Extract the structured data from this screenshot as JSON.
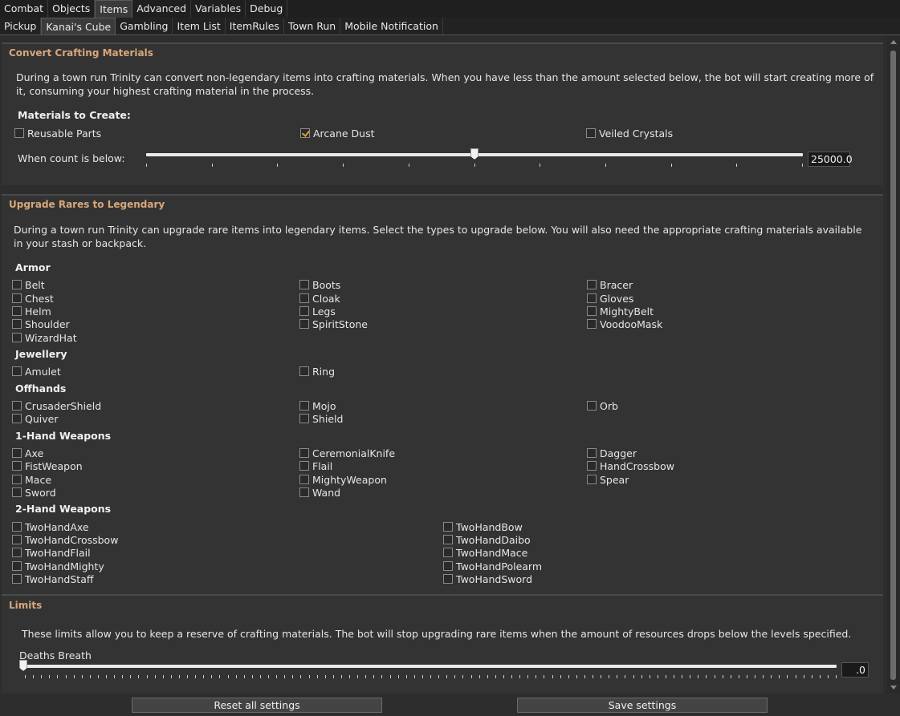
{
  "tabs_top": [
    "Combat",
    "Objects",
    "Items",
    "Advanced",
    "Variables",
    "Debug"
  ],
  "tabs_sub": [
    "Pickup",
    "Kanai's Cube",
    "Gambling",
    "Item List",
    "ItemRules",
    "Town Run",
    "Mobile Notification"
  ],
  "convert": {
    "title": "Convert Crafting Materials",
    "description": "During a town run Trinity can convert non-legendary items into crafting materials. When you have less than the amount selected below, the bot will start creating more of it, consuming your highest crafting material in the process.",
    "materials_label": "Materials to Create:",
    "materials": [
      {
        "label": "Reusable Parts",
        "checked": false
      },
      {
        "label": "Arcane Dust",
        "checked": true
      },
      {
        "label": "Veiled Crystals",
        "checked": false
      }
    ],
    "count_label": "When count is below:",
    "count_value": "25000.0",
    "count_fraction": 0.5
  },
  "upgrade": {
    "title": "Upgrade Rares to Legendary",
    "description": "During a town run Trinity can upgrade rare items into legendary items. Select the types to upgrade below. You will also need the appropriate crafting materials available in your stash or backpack.",
    "groups": {
      "armor": {
        "label": "Armor",
        "items": [
          "Belt",
          "Boots",
          "Bracer",
          "Chest",
          "Cloak",
          "Gloves",
          "Helm",
          "Legs",
          "MightyBelt",
          "Shoulder",
          "SpiritStone",
          "VoodooMask",
          "WizardHat"
        ]
      },
      "jewellery": {
        "label": "Jewellery",
        "items": [
          "Amulet",
          "Ring"
        ]
      },
      "offhands": {
        "label": "Offhands",
        "items": [
          "CrusaderShield",
          "Mojo",
          "Orb",
          "Quiver",
          "Shield"
        ]
      },
      "onehand": {
        "label": "1-Hand Weapons",
        "items": [
          "Axe",
          "CeremonialKnife",
          "Dagger",
          "FistWeapon",
          "Flail",
          "HandCrossbow",
          "Mace",
          "MightyWeapon",
          "Spear",
          "Sword",
          "Wand"
        ]
      },
      "twohand": {
        "label": "2-Hand Weapons",
        "items": [
          "TwoHandAxe",
          "TwoHandBow",
          "TwoHandCrossbow",
          "TwoHandDaibo",
          "TwoHandFlail",
          "TwoHandMace",
          "TwoHandMighty",
          "TwoHandPolearm",
          "TwoHandStaff",
          "TwoHandSword"
        ]
      }
    }
  },
  "limits": {
    "title": "Limits",
    "description": "These limits allow you to keep a reserve of crafting materials. The bot will stop upgrading rare items when the amount of resources drops below the levels specified.",
    "deaths_breath_label": "Deaths Breath",
    "deaths_breath_value": ".0",
    "deaths_breath_fraction": 0
  },
  "buttons": {
    "reset": "Reset all settings",
    "save": "Save settings"
  },
  "colors": {
    "section_title": "#d9a77a",
    "checkmark": "#d9a037"
  }
}
